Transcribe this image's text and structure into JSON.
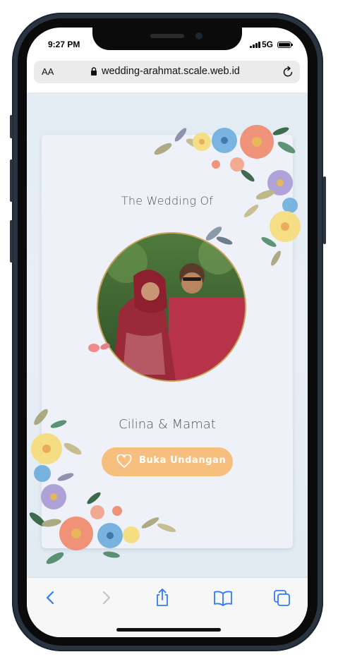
{
  "status_bar": {
    "time": "9:27 PM",
    "network": "5G"
  },
  "browser": {
    "text_size_label": "AA",
    "url": "wedding-arahmat.scale.web.id"
  },
  "invitation": {
    "heading": "The Wedding Of",
    "couple_names": "Cilina & Mamat",
    "open_button_label": "Buka Undangan"
  },
  "colors": {
    "accent_button": "#f7bf7e",
    "page_background": "#e3ecf3",
    "card_background": "#eef2f8",
    "frame": "#2a3441",
    "toolbar_icon": "#2f7cf6"
  },
  "icons": {
    "status": [
      "signal-icon",
      "battery-icon"
    ],
    "urlbar": [
      "lock-icon",
      "reload-icon"
    ],
    "button": "heart-icon",
    "toolbar": [
      "back-icon",
      "forward-icon",
      "share-icon",
      "bookmarks-icon",
      "tabs-icon"
    ]
  }
}
